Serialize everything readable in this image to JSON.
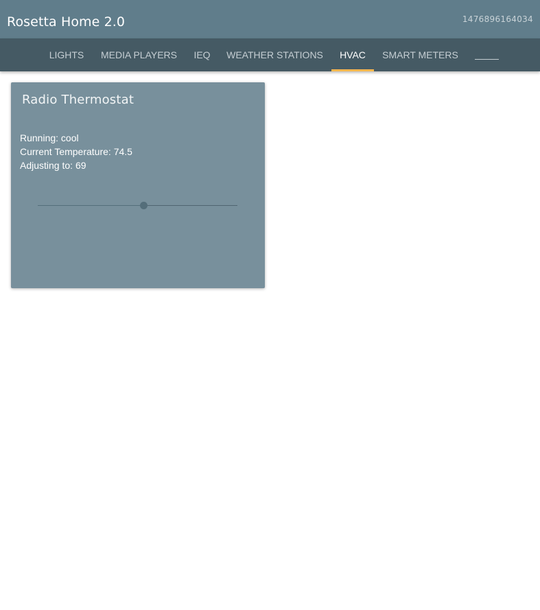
{
  "app": {
    "title": "Rosetta Home 2.0",
    "timestamp": "1476896164034"
  },
  "tabs": [
    {
      "label": "LIGHTS",
      "active": false
    },
    {
      "label": "MEDIA PLAYERS",
      "active": false
    },
    {
      "label": "IEQ",
      "active": false
    },
    {
      "label": "WEATHER STATIONS",
      "active": false
    },
    {
      "label": "HVAC",
      "active": true
    },
    {
      "label": "SMART METERS",
      "active": false
    }
  ],
  "thermostat": {
    "title": "Radio Thermostat",
    "running_line": "Running: cool",
    "current_temp_line": "Current Temperature: 74.5",
    "adjusting_line": "Adjusting to: 69",
    "setpoint_slider_fraction": 0.53
  },
  "colors": {
    "app_bar": "#607d8b",
    "tab_bar": "#455a64",
    "tab_indicator": "#ffb74d",
    "card": "#78909c"
  },
  "icons": {
    "tab_more": "more-tabs-icon"
  }
}
